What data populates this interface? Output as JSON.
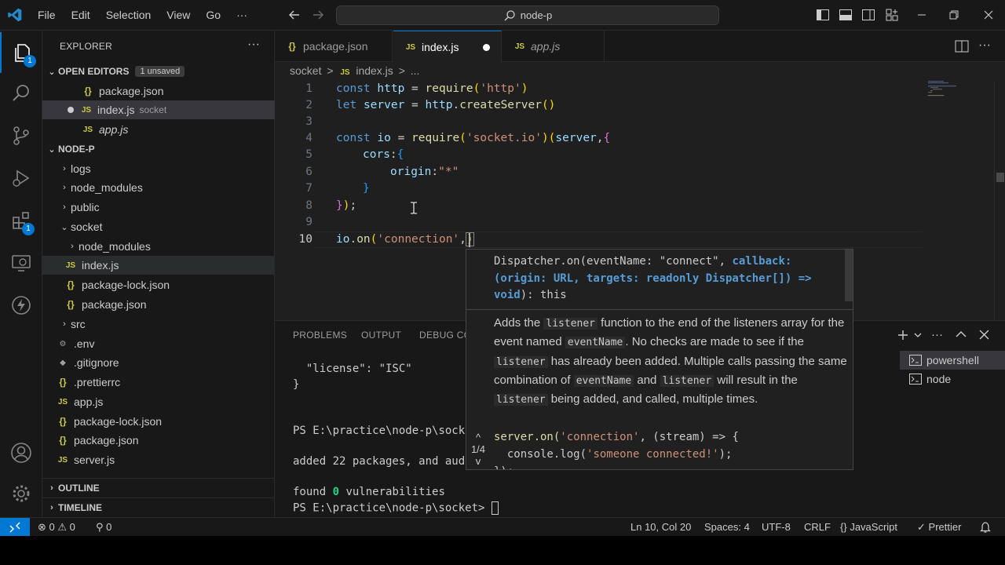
{
  "title_bar": {
    "menu": [
      "File",
      "Edit",
      "Selection",
      "View",
      "Go",
      "···"
    ],
    "search_text": "node-p"
  },
  "activity_bar": {
    "explorer_badge": "1",
    "extensions_badge": "1"
  },
  "explorer": {
    "title": "EXPLORER",
    "open_editors_label": "OPEN EDITORS",
    "unsaved_badge": "1 unsaved",
    "open_editors": [
      {
        "icon": "{}",
        "name": "package.json",
        "desc": ""
      },
      {
        "icon": "JS",
        "name": "index.js",
        "desc": "socket"
      },
      {
        "icon": "JS",
        "name": "app.js",
        "desc": ""
      }
    ],
    "folder_label": "NODE-P",
    "tree": [
      {
        "icon": "›",
        "name": "logs"
      },
      {
        "icon": "›",
        "name": "node_modules"
      },
      {
        "icon": "›",
        "name": "public"
      },
      {
        "icon": "⌄",
        "name": "socket"
      },
      {
        "icon": "›",
        "name": "node_modules"
      },
      {
        "icon": "JS",
        "name": "index.js"
      },
      {
        "icon": "{}",
        "name": "package-lock.json"
      },
      {
        "icon": "{}",
        "name": "package.json"
      },
      {
        "icon": "›",
        "name": "src"
      },
      {
        "icon": "⚙",
        "name": ".env"
      },
      {
        "icon": "◆",
        "name": ".gitignore"
      },
      {
        "icon": "{}",
        "name": ".prettierrc"
      },
      {
        "icon": "JS",
        "name": "app.js"
      },
      {
        "icon": "{}",
        "name": "package-lock.json"
      },
      {
        "icon": "{}",
        "name": "package.json"
      },
      {
        "icon": "JS",
        "name": "server.js"
      }
    ],
    "outline_label": "OUTLINE",
    "timeline_label": "TIMELINE"
  },
  "tabs": [
    {
      "icon": "{}",
      "name": "package.json"
    },
    {
      "icon": "JS",
      "name": "index.js"
    },
    {
      "icon": "JS",
      "name": "app.js"
    }
  ],
  "breadcrumb": {
    "folder": "socket",
    "sep": ">",
    "file_icon": "JS",
    "file": "index.js",
    "sep2": ">",
    "tail": "..."
  },
  "line_numbers": [
    "1",
    "2",
    "3",
    "4",
    "5",
    "6",
    "7",
    "8",
    "9",
    "10"
  ],
  "code": {
    "l1": {
      "kw": "const",
      "var": "http",
      "eq": " = ",
      "fn": "require",
      "open": "(",
      "str": "'http'",
      "close": ")"
    },
    "l2": {
      "kw": "let",
      "var": "server",
      "eq": " = ",
      "obj": "http",
      "dot": ".",
      "fn": "createServer",
      "parens": "()"
    },
    "l4": {
      "kw": "const",
      "var": "io",
      "eq": " = ",
      "fn": "require",
      "open": "(",
      "str": "'socket.io'",
      "close": ")",
      "open2": "(",
      "arg": "server",
      "comma": ",",
      "brace": "{"
    },
    "l5": {
      "key": "cors",
      "colon": ":",
      "brace": "{"
    },
    "l6": {
      "key": "origin",
      "colon": ":",
      "str": "\"*\""
    },
    "l7": {
      "brace": "}"
    },
    "l8": {
      "brace": "}",
      "paren": ")",
      "semi": ";"
    },
    "l10": {
      "obj": "io",
      "dot": ".",
      "fn": "on",
      "open": "(",
      "str": "'connection'",
      "comma": ",",
      "close": ")"
    }
  },
  "hover": {
    "sig_1a": "Dispatcher.on(eventName: \"connect\", ",
    "sig_1b": "callback:",
    "sig_2": "(origin: URL, targets: readonly Dispatcher[]) =>",
    "sig_3a": "void",
    "sig_3b": "): this",
    "doc_1": "Adds the ",
    "doc_code_1": "listener",
    "doc_2": " function to the end of the listeners array for the event named ",
    "doc_code_2": "eventName",
    "doc_3": ". No checks are made to see if the ",
    "doc_code_3": "listener",
    "doc_4": " has already been added. Multiple calls passing the same combination of ",
    "doc_code_4": "eventName",
    "doc_5": " and ",
    "doc_code_5": "listener",
    "doc_6": " will result in the ",
    "doc_code_6": "listener",
    "doc_7": " being added, and called, multiple times.",
    "ex_1a": "server.on(",
    "ex_1b": "'connection'",
    "ex_1c": ", (stream) => {",
    "ex_2a": "  console.log(",
    "ex_2b": "'someone connected!'",
    "ex_2c": ");",
    "ex_3": "});",
    "nav_up": "^",
    "nav_count": "1/4",
    "nav_down": "v"
  },
  "panel": {
    "tabs": [
      "PROBLEMS",
      "OUTPUT",
      "DEBUG CO"
    ],
    "terminal": [
      "  \"license\": \"ISC\"",
      "}",
      "PS E:\\practice\\node-p\\sock",
      "added 22 packages, and aud",
      "found ",
      "0",
      " vulnerabilities",
      "PS E:\\practice\\node-p\\socket> "
    ],
    "terminals": [
      "powershell",
      "node"
    ]
  },
  "status_bar": {
    "errors": "0",
    "warnings": "0",
    "ports": "0",
    "position": "Ln 10, Col 20",
    "spaces": "Spaces: 4",
    "encoding": "UTF-8",
    "eol": "CRLF",
    "language_icon": "{}",
    "language": "JavaScript",
    "formatter": "Prettier"
  },
  "colors": {
    "accent": "#0078d4",
    "keyword": "#569cd6",
    "variable": "#9cdcfe",
    "function": "#dcdcaa",
    "string": "#ce9178",
    "js_icon": "#cbcb41"
  }
}
